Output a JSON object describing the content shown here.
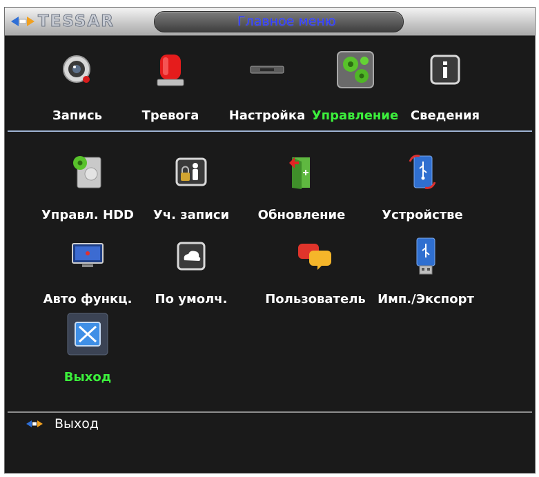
{
  "brand": {
    "logo_text": "TESSAR"
  },
  "window": {
    "title": "Главное меню"
  },
  "tabs": [
    {
      "label": "Запись",
      "icon": "camera-record-icon"
    },
    {
      "label": "Тревога",
      "icon": "alarm-siren-icon"
    },
    {
      "label": "Настройка",
      "icon": "settings-device-icon"
    },
    {
      "label": "Управление",
      "icon": "gears-icon",
      "active": true
    },
    {
      "label": "Сведения",
      "icon": "info-icon"
    }
  ],
  "items": [
    {
      "label": "Управл. HDD",
      "icon": "hdd-gear-icon"
    },
    {
      "label": "Уч. записи",
      "icon": "user-lock-icon"
    },
    {
      "label": "Обновление",
      "icon": "update-folder-icon"
    },
    {
      "label": "Устройстве",
      "icon": "usb-device-icon"
    },
    {
      "label": "Авто функц.",
      "icon": "monitor-icon"
    },
    {
      "label": "По умолч.",
      "icon": "default-restore-icon"
    },
    {
      "label": "Пользователь",
      "icon": "chat-bubbles-icon"
    },
    {
      "label": "Имп./Экспорт",
      "icon": "usb-drive-icon"
    },
    {
      "label": "Выход",
      "icon": "exit-icon",
      "selected": true
    }
  ],
  "status": {
    "text": "Выход",
    "icon": "nav-arrows-icon"
  },
  "colors": {
    "active_label": "#3cf03c",
    "title_text": "#2e3bff",
    "background": "#1a1a1a",
    "divider": "#9fb4d4"
  }
}
